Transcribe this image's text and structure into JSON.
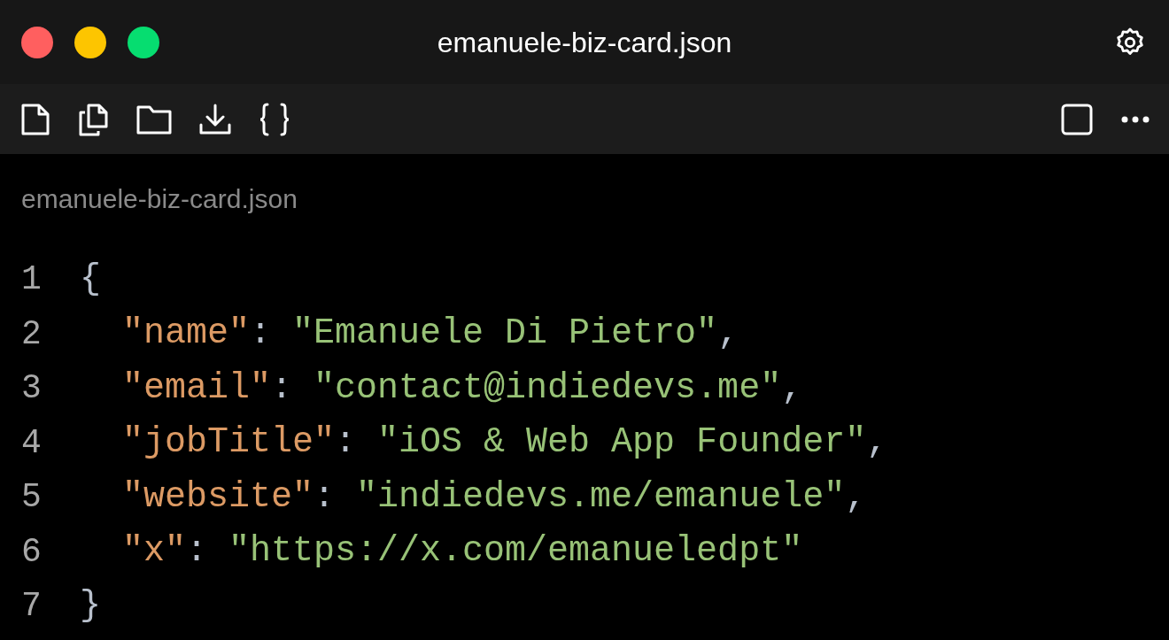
{
  "window": {
    "title": "emanuele-biz-card.json"
  },
  "editor": {
    "file_label": "emanuele-biz-card.json",
    "lines": [
      {
        "number": "1",
        "indented": false,
        "tokens": [
          {
            "kind": "punct",
            "text": "{"
          }
        ]
      },
      {
        "number": "2",
        "indented": true,
        "tokens": [
          {
            "kind": "key",
            "text": "\"name\""
          },
          {
            "kind": "punct",
            "text": ": "
          },
          {
            "kind": "string",
            "text": "\"Emanuele Di Pietro\""
          },
          {
            "kind": "punct",
            "text": ","
          }
        ]
      },
      {
        "number": "3",
        "indented": true,
        "tokens": [
          {
            "kind": "key",
            "text": "\"email\""
          },
          {
            "kind": "punct",
            "text": ": "
          },
          {
            "kind": "string",
            "text": "\"contact@indiedevs.me\""
          },
          {
            "kind": "punct",
            "text": ","
          }
        ]
      },
      {
        "number": "4",
        "indented": true,
        "tokens": [
          {
            "kind": "key",
            "text": "\"jobTitle\""
          },
          {
            "kind": "punct",
            "text": ": "
          },
          {
            "kind": "string",
            "text": "\"iOS & Web App Founder\""
          },
          {
            "kind": "punct",
            "text": ","
          }
        ]
      },
      {
        "number": "5",
        "indented": true,
        "tokens": [
          {
            "kind": "key",
            "text": "\"website\""
          },
          {
            "kind": "punct",
            "text": ": "
          },
          {
            "kind": "string",
            "text": "\"indiedevs.me/emanuele\""
          },
          {
            "kind": "punct",
            "text": ","
          }
        ]
      },
      {
        "number": "6",
        "indented": true,
        "tokens": [
          {
            "kind": "key",
            "text": "\"x\""
          },
          {
            "kind": "punct",
            "text": ": "
          },
          {
            "kind": "string",
            "text": "\"https://x.com/emanueledpt\""
          }
        ]
      },
      {
        "number": "7",
        "indented": false,
        "tokens": [
          {
            "kind": "punct",
            "text": "}"
          }
        ]
      }
    ]
  }
}
